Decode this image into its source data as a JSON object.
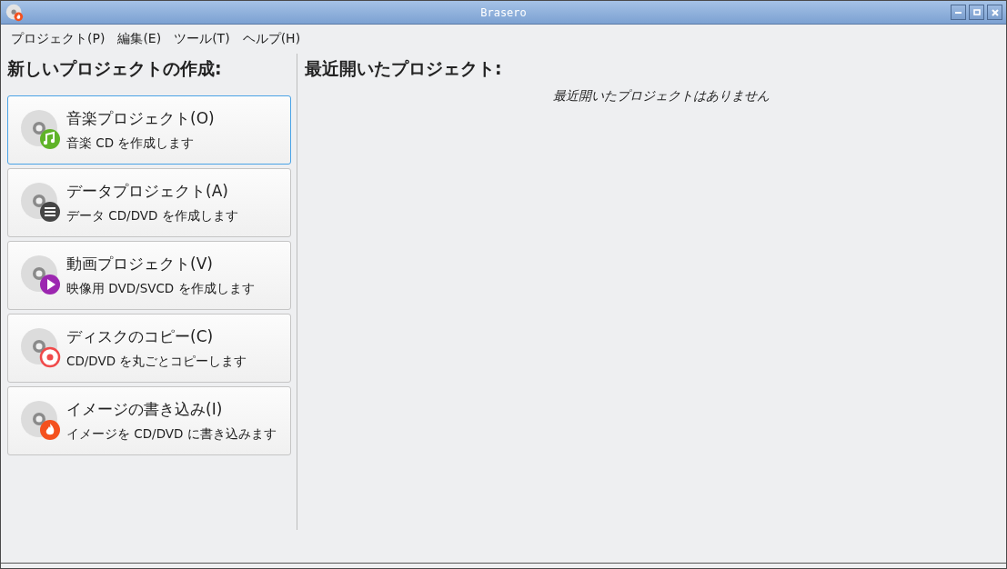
{
  "window": {
    "title": "Brasero"
  },
  "menu": [
    "プロジェクト(P)",
    "編集(E)",
    "ツール(T)",
    "ヘルプ(H)"
  ],
  "new_project": {
    "heading": "新しいプロジェクトの作成:",
    "items": [
      {
        "kind": "music",
        "title": "音楽プロジェクト(O)",
        "description": "音楽 CD を作成します",
        "selected": true
      },
      {
        "kind": "data",
        "title": "データプロジェクト(A)",
        "description": "データ CD/DVD を作成します",
        "selected": false
      },
      {
        "kind": "video",
        "title": "動画プロジェクト(V)",
        "description": "映像用 DVD/SVCD を作成します",
        "selected": false
      },
      {
        "kind": "copy",
        "title": "ディスクのコピー(C)",
        "description": "CD/DVD を丸ごとコピーします",
        "selected": false
      },
      {
        "kind": "burn",
        "title": "イメージの書き込み(I)",
        "description": "イメージを CD/DVD に書き込みます",
        "selected": false
      }
    ]
  },
  "recent": {
    "heading": "最近開いたプロジェクト:",
    "empty_message": "最近開いたプロジェクトはありません"
  }
}
